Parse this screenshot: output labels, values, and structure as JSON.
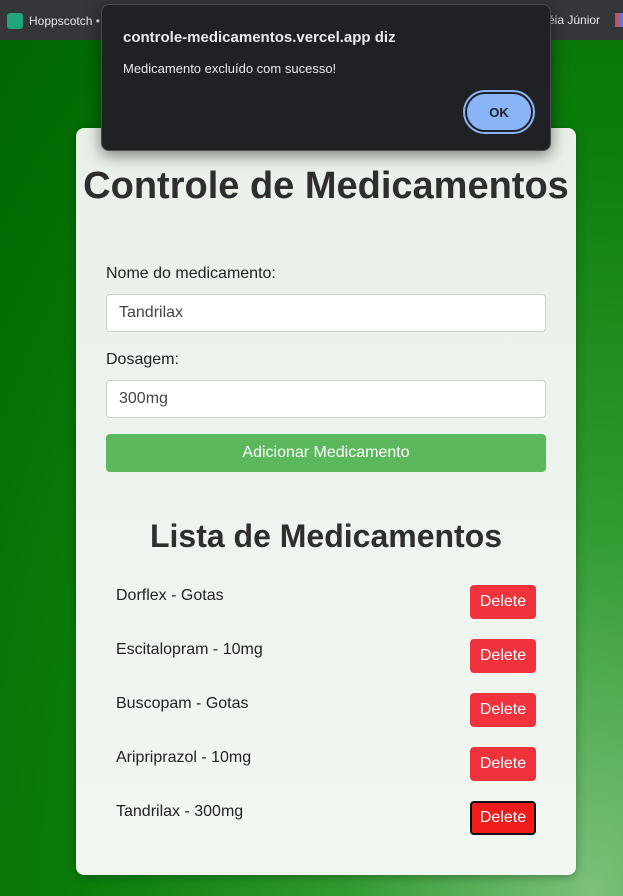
{
  "browser": {
    "bookmarks": [
      {
        "label": "Hoppscotch •",
        "icon": "hoppscotch-icon"
      },
      {
        "label": "éia Júnior",
        "icon": "none"
      }
    ]
  },
  "app": {
    "title": "Controle de Medicamentos",
    "name_label": "Nome do medicamento:",
    "name_value": "Tandrilax",
    "dose_label": "Dosagem:",
    "dose_value": "300mg",
    "add_button": "Adicionar Medicamento",
    "list_title": "Lista de Medicamentos",
    "items": [
      {
        "text": "Dorflex - Gotas",
        "delete": "Delete"
      },
      {
        "text": "Escitalopram - 10mg",
        "delete": "Delete"
      },
      {
        "text": "Buscopam - Gotas",
        "delete": "Delete"
      },
      {
        "text": "Aripriprazol - 10mg",
        "delete": "Delete"
      },
      {
        "text": "Tandrilax - 300mg",
        "delete": "Delete"
      }
    ]
  },
  "alert": {
    "title": "controle-medicamentos.vercel.app diz",
    "message": "Medicamento excluído com sucesso!",
    "ok": "OK"
  },
  "colors": {
    "add_button": "#5cb85c",
    "delete_button": "#f0323c",
    "ok_button": "#8ab4f8",
    "alert_bg": "#1f2124"
  }
}
